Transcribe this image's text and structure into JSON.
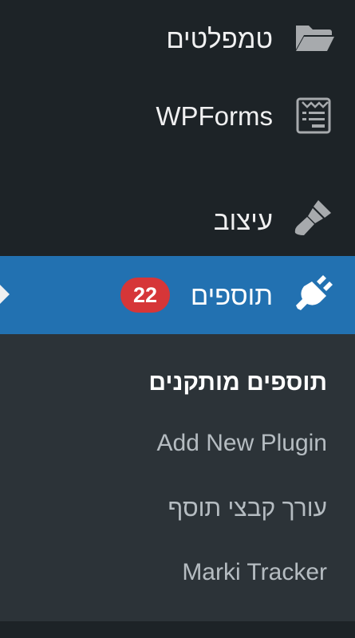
{
  "menu": {
    "templates": {
      "label": "טמפלטים",
      "icon": "folder-open-icon"
    },
    "wpforms": {
      "label": "WPForms",
      "icon": "form-icon"
    },
    "design": {
      "label": "עיצוב",
      "icon": "paintbrush-icon"
    },
    "plugins": {
      "label": "תוספים",
      "icon": "plug-icon",
      "badge": "22"
    }
  },
  "submenu": {
    "installed": "תוספים מותקנים",
    "add_new": "Add New Plugin",
    "editor": "עורך קבצי תוסף",
    "marki": "Marki Tracker"
  },
  "colors": {
    "sidebar_bg": "#1d2327",
    "submenu_bg": "#2c3338",
    "active_bg": "#2271b1",
    "badge_bg": "#d63638"
  }
}
